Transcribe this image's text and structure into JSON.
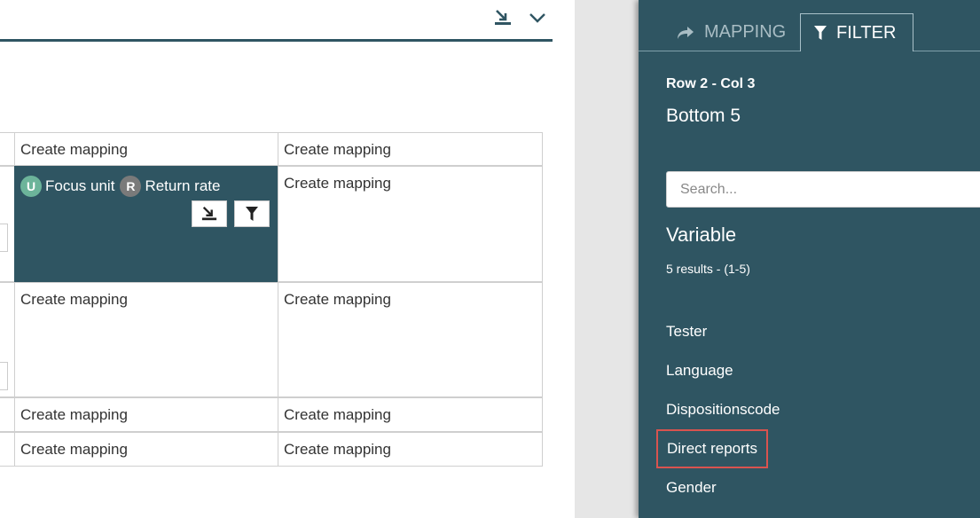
{
  "toolbar": {
    "icons": [
      "import-icon",
      "chevron-down-icon"
    ]
  },
  "grid": {
    "rows": [
      {
        "col_a": "Create mapping",
        "col_b": "Create mapping"
      },
      {
        "col_a_selected": {
          "u_badge": "U",
          "u_label": "Focus unit",
          "r_badge": "R",
          "r_label": "Return rate"
        },
        "col_b": "Create mapping"
      },
      {
        "col_a": "Create mapping",
        "col_b": "Create mapping"
      },
      {
        "col_a": "Create mapping",
        "col_b": "Create mapping"
      },
      {
        "col_a": "Create mapping",
        "col_b": "Create mapping"
      }
    ]
  },
  "panel": {
    "tabs": [
      {
        "label": "MAPPING",
        "icon": "arrow-right-icon",
        "active": false
      },
      {
        "label": "FILTER",
        "icon": "filter-icon",
        "active": true
      }
    ],
    "cell_ref": "Row 2 - Col 3",
    "subtitle": "Bottom 5",
    "search_placeholder": "Search...",
    "section_title": "Variable",
    "results": "5 results - (1-5)",
    "items": [
      "Tester",
      "Language",
      "Dispositionscode",
      "Direct reports",
      "Gender"
    ],
    "highlighted_item": "Direct reports",
    "colors": {
      "panel_bg": "#2f5562",
      "badge_u": "#6cb49a",
      "badge_r": "#7a7a7a",
      "highlight": "#d9534f"
    }
  }
}
